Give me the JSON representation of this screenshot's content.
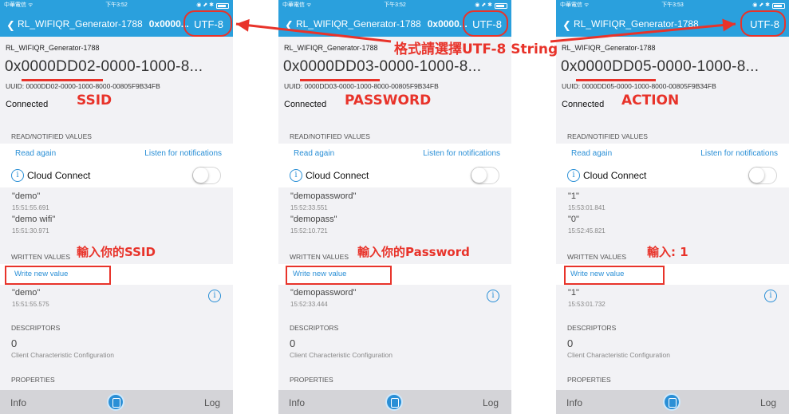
{
  "status_bar": {
    "carrier": "中華電信 ᯤ",
    "right_icons": "◉ ⬈ ✱"
  },
  "nav": {
    "back_icon": "chevron-left-icon",
    "encoding": "UTF-8"
  },
  "labels": {
    "read_header": "READ/NOTIFIED VALUES",
    "read_again": "Read again",
    "listen": "Listen for notifications",
    "cloud_connect": "Cloud Connect",
    "written_header": "WRITTEN VALUES",
    "write_new": "Write new value",
    "descriptors_header": "DESCRIPTORS",
    "descriptor_value": "0",
    "descriptor_name": "Client Characteristic Configuration",
    "properties_header": "PROPERTIES",
    "connected": "Connected"
  },
  "tabbar": {
    "info": "Info",
    "log": "Log"
  },
  "panels": [
    {
      "time": "下午3:52",
      "nav_title": "RL_WIFIQR_Generator-1788",
      "nav_sub": "0x0000...",
      "device_name": "RL_WIFIQR_Generator-1788",
      "uuid_big": {
        "prefix": "0x",
        "code": "0000DD02",
        "rest": "-0000-1000-8..."
      },
      "uuid_full": "UUID: 0000DD02-0000-1000-8000-00805F9B34FB",
      "read_values": [
        {
          "value": "\"demo\"",
          "time": "15:51:55.691"
        },
        {
          "value": "\"demo wifi\"",
          "time": "15:51:30.971"
        }
      ],
      "written_value": {
        "value": "\"demo\"",
        "time": "15:51:55.575"
      },
      "annotation_top": "SSID",
      "annotation_write": "輸入你的SSID"
    },
    {
      "time": "下午3:52",
      "nav_title": "RL_WIFIQR_Generator-1788",
      "nav_sub": "0x0000...",
      "device_name": "RL_WIFIQR_Generator-1788",
      "uuid_big": {
        "prefix": "0x",
        "code": "0000DD03",
        "rest": "-0000-1000-8..."
      },
      "uuid_full": "UUID: 0000DD03-0000-1000-8000-00805F9B34FB",
      "read_values": [
        {
          "value": "\"demopassword\"",
          "time": "15:52:33.551"
        },
        {
          "value": "\"demopass\"",
          "time": "15:52:10.721"
        }
      ],
      "written_value": {
        "value": "\"demopassword\"",
        "time": "15:52:33.444"
      },
      "annotation_top": "PASSWORD",
      "annotation_write": "輸入你的Password"
    },
    {
      "time": "下午3:53",
      "nav_title": "RL_WIFIQR_Generator-1788",
      "nav_sub": "",
      "device_name": "RL_WIFIQR_Generator-1788",
      "uuid_big": {
        "prefix": "0x",
        "code": "0000DD05",
        "rest": "-0000-1000-8..."
      },
      "uuid_full": "UUID: 0000DD05-0000-1000-8000-00805F9B34FB",
      "read_values": [
        {
          "value": "\"1\"",
          "time": "15:53:01.841"
        },
        {
          "value": "\"0\"",
          "time": "15:52:45.821"
        }
      ],
      "written_value": {
        "value": "\"1\"",
        "time": "15:53:01.732"
      },
      "annotation_top": "ACTION",
      "annotation_write": "輸入: 1"
    }
  ],
  "annotation_encoding": "格式請選擇UTF-8 String",
  "colors": {
    "nav": "#2aa0dd",
    "link": "#2a8fd6",
    "annotation": "#e8332a"
  }
}
